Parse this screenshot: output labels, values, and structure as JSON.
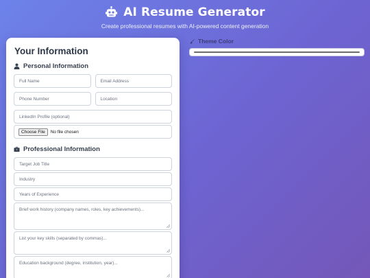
{
  "header": {
    "title": "AI Resume Generator",
    "subtitle": "Create professional resumes with AI-powered content generation",
    "logo_icon": "robot-icon"
  },
  "form": {
    "title": "Your Information",
    "personal": {
      "heading": "Personal Information",
      "icon": "user-icon",
      "full_name_placeholder": "Full Name",
      "email_placeholder": "Email Address",
      "phone_placeholder": "Phone Number",
      "location_placeholder": "Location",
      "linkedin_placeholder": "LinkedIn Profile (optional)",
      "file_button": "Choose File",
      "file_status": "No file chosen"
    },
    "professional": {
      "heading": "Professional Information",
      "icon": "briefcase-icon",
      "job_title_placeholder": "Target Job Title",
      "industry_placeholder": "Industry",
      "experience_placeholder": "Years of Experience",
      "work_history_placeholder": "Brief work history (company names, roles, key achievements)...",
      "skills_placeholder": "List your key skills (separated by commas)...",
      "education_placeholder": "Education background (degree, institution, year)..."
    }
  },
  "theme": {
    "label": "Theme Color",
    "icon": "paintbrush-icon",
    "value": "#6b6b6b"
  }
}
